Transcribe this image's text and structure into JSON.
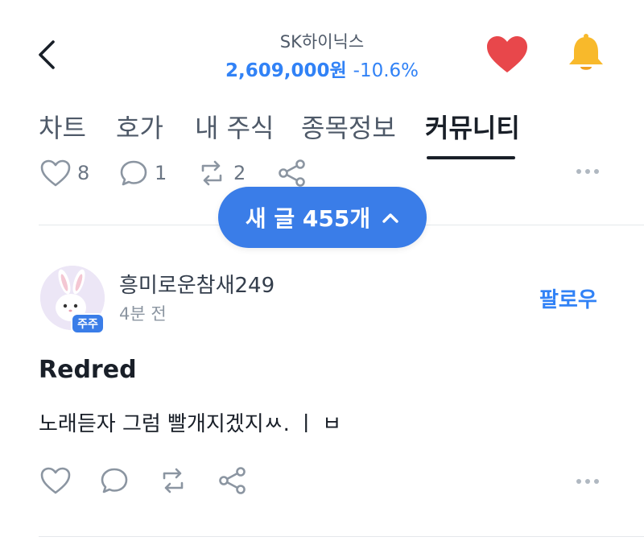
{
  "header": {
    "stock_name": "SK하이닉스",
    "price": "2,609,000원",
    "change": "-10.6%",
    "icons": {
      "back": "back-chevron-icon",
      "heart": "heart-icon",
      "bell": "bell-icon"
    }
  },
  "tabs": [
    {
      "label": "차트"
    },
    {
      "label": "호가"
    },
    {
      "label": "내 주식"
    },
    {
      "label": "종목정보"
    },
    {
      "label": "커뮤니티",
      "active": true
    }
  ],
  "previous_post": {
    "likes": "8",
    "comments": "1",
    "reposts": "2"
  },
  "new_posts_pill": {
    "label": "새 글 455개"
  },
  "post": {
    "author": "흥미로운참새249",
    "badge": "주주",
    "time": "4분 전",
    "follow_label": "팔로우",
    "title": "Redred",
    "body": "노래듣자 그럼 빨개지겠지ㅆ. ㅣ ㅂ"
  },
  "colors": {
    "accent": "#3182f6",
    "pill": "#3a7de8",
    "heart": "#e8474b",
    "bell": "#f8b92b",
    "text": "#191f28",
    "muted": "#8b95a1"
  }
}
